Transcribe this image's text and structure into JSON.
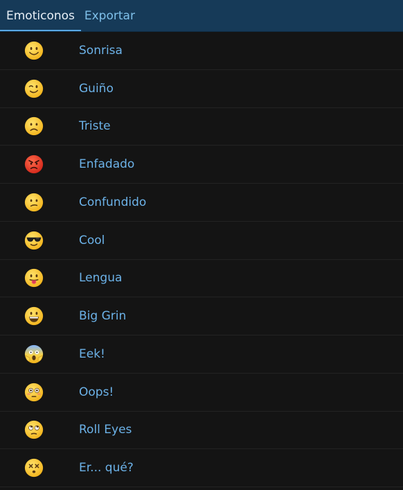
{
  "tabs": [
    {
      "label": "Emoticonos",
      "active": true
    },
    {
      "label": "Exportar",
      "active": false
    }
  ],
  "emoticons": [
    {
      "label": "Sonrisa",
      "icon": "smile-icon"
    },
    {
      "label": "Guiño",
      "icon": "wink-icon"
    },
    {
      "label": "Triste",
      "icon": "sad-icon"
    },
    {
      "label": "Enfadado",
      "icon": "angry-icon"
    },
    {
      "label": "Confundido",
      "icon": "confused-icon"
    },
    {
      "label": "Cool",
      "icon": "sunglasses-icon"
    },
    {
      "label": "Lengua",
      "icon": "tongue-icon"
    },
    {
      "label": "Big Grin",
      "icon": "big-grin-icon"
    },
    {
      "label": "Eek!",
      "icon": "scream-icon"
    },
    {
      "label": "Oops!",
      "icon": "flushed-icon"
    },
    {
      "label": "Roll Eyes",
      "icon": "roll-eyes-icon"
    },
    {
      "label": "Er... qué?",
      "icon": "dizzy-icon"
    }
  ],
  "colors": {
    "tabbar": "#163a58",
    "accent": "#5aa9e6",
    "label": "#6cb2e8",
    "background": "#141414"
  }
}
